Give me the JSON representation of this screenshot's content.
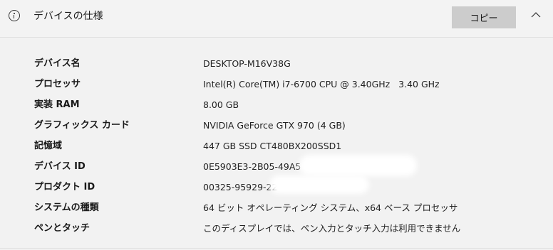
{
  "header": {
    "title": "デバイスの仕様",
    "copy_label": "コピー",
    "icons": {
      "info": "info-circle-icon",
      "collapse": "chevron-up-icon"
    }
  },
  "specs": [
    {
      "label": "デバイス名",
      "value": "DESKTOP-M16V38G"
    },
    {
      "label": "プロセッサ",
      "value": "Intel(R) Core(TM) i7-6700 CPU @ 3.40GHz   3.40 GHz"
    },
    {
      "label": "実装 RAM",
      "value": "8.00 GB"
    },
    {
      "label": "グラフィックス カード",
      "value": "NVIDIA GeForce GTX 970 (4 GB)"
    },
    {
      "label": "記憶域",
      "value": "447 GB SSD CT480BX200SSD1"
    },
    {
      "label": "デバイス ID",
      "value": "0E5903E3-2B05-49A5"
    },
    {
      "label": "プロダクト ID",
      "value": "00325-95929-22"
    },
    {
      "label": "システムの種類",
      "value": "64 ビット オペレーティング システム、x64 ベース プロセッサ"
    },
    {
      "label": "ペンとタッチ",
      "value": "このディスプレイでは、ペン入力とタッチ入力は利用できません"
    }
  ]
}
